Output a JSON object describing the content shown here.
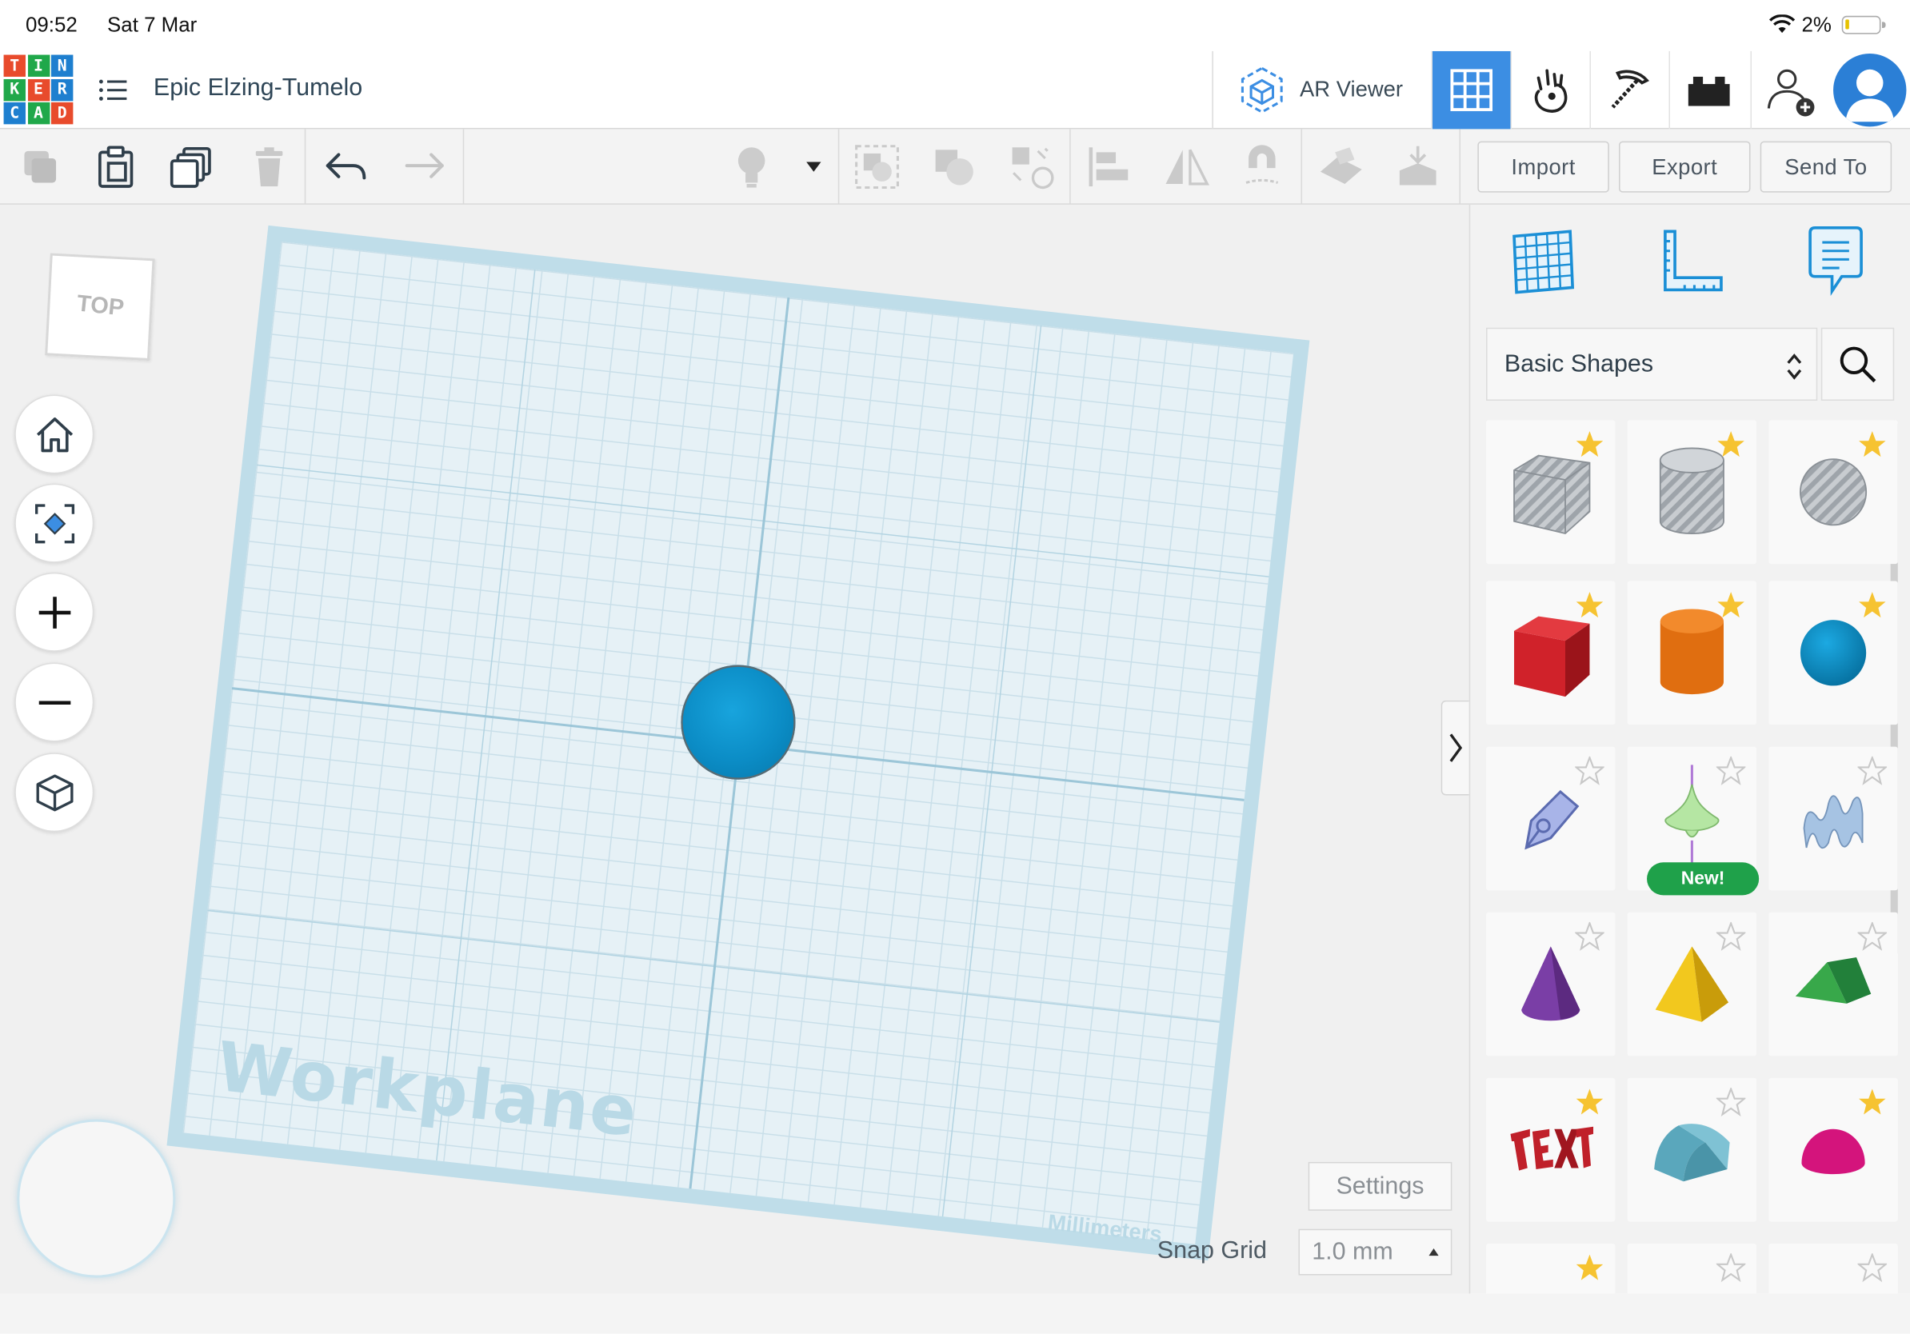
{
  "status_bar": {
    "time": "09:52",
    "date": "Sat 7 Mar",
    "battery": "2%"
  },
  "app": {
    "logo_letters": [
      "T",
      "I",
      "N",
      "K",
      "E",
      "R",
      "C",
      "A",
      "D"
    ],
    "design_title": "Epic Elzing-Tumelo",
    "ar_viewer_label": "AR Viewer"
  },
  "toolbar": {
    "import_label": "Import",
    "export_label": "Export",
    "send_to_label": "Send To"
  },
  "workplane": {
    "label": "Workplane",
    "units": "Millimeters",
    "view_cube_face": "TOP"
  },
  "snap": {
    "settings_label": "Settings",
    "snap_grid_label": "Snap Grid",
    "snap_grid_value": "1.0 mm"
  },
  "panel": {
    "library": "Basic Shapes",
    "new_badge": "New!",
    "shapes": [
      {
        "name": "box-hole",
        "favorite": true
      },
      {
        "name": "cylinder-hole",
        "favorite": true
      },
      {
        "name": "sphere-hole",
        "favorite": true
      },
      {
        "name": "box",
        "favorite": true
      },
      {
        "name": "cylinder",
        "favorite": true
      },
      {
        "name": "sphere",
        "favorite": true
      },
      {
        "name": "scribble",
        "favorite": false
      },
      {
        "name": "spinning-top",
        "favorite": false
      },
      {
        "name": "shape-generator",
        "favorite": false
      },
      {
        "name": "cone",
        "favorite": false
      },
      {
        "name": "pyramid",
        "favorite": false
      },
      {
        "name": "roof",
        "favorite": false
      },
      {
        "name": "text",
        "favorite": true
      },
      {
        "name": "half-cylinder",
        "favorite": false
      },
      {
        "name": "half-sphere",
        "favorite": true
      }
    ]
  },
  "colors": {
    "accent": "#3c8ee3",
    "favorite_star": "#f6c331",
    "new_badge": "#1fa14a",
    "sphere": "#0b8cc5"
  }
}
